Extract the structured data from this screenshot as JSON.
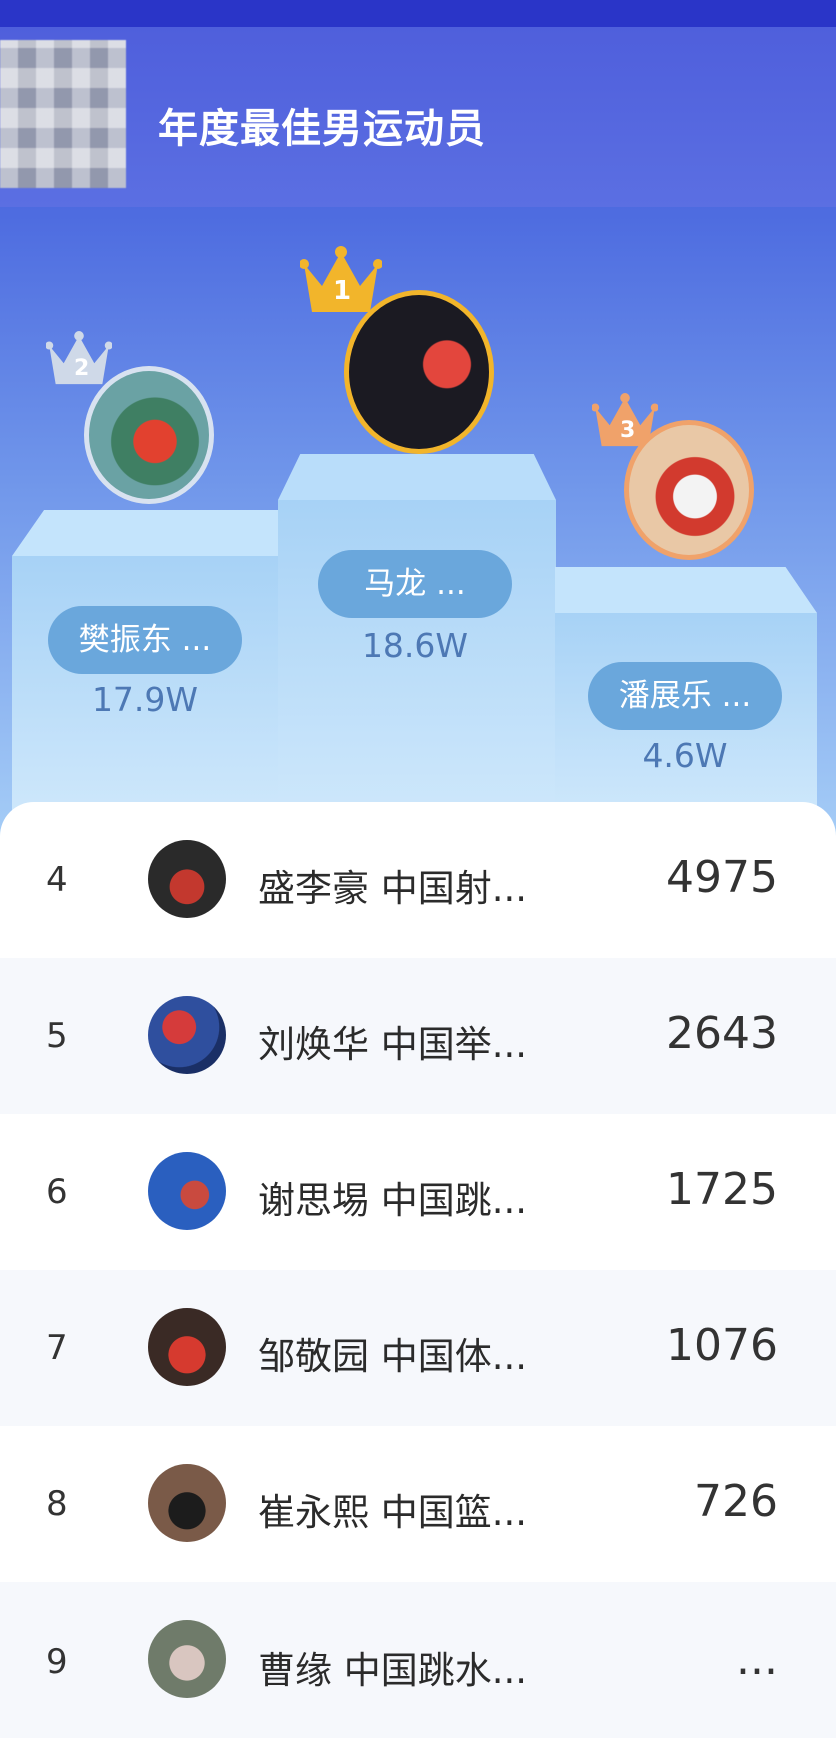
{
  "header": {
    "title": "年度最佳男运动员"
  },
  "podium": [
    {
      "rank": "2",
      "name": "樊振东 ...",
      "score": "17.9W"
    },
    {
      "rank": "1",
      "name": "马龙 ...",
      "score": "18.6W"
    },
    {
      "rank": "3",
      "name": "潘展乐 ...",
      "score": "4.6W"
    }
  ],
  "list": [
    {
      "rank": "4",
      "name": "盛李豪  中国射...",
      "value": "4975"
    },
    {
      "rank": "5",
      "name": "刘焕华  中国举...",
      "value": "2643"
    },
    {
      "rank": "6",
      "name": "谢思埸  中国跳...",
      "value": "1725"
    },
    {
      "rank": "7",
      "name": "邹敬园  中国体...",
      "value": "1076"
    },
    {
      "rank": "8",
      "name": "崔永熙  中国篮...",
      "value": "726"
    },
    {
      "rank": "9",
      "name": "曹缘  中国跳水...",
      "value": "..."
    }
  ],
  "colors": {
    "gold": "#f2b52b",
    "silver": "#d8e2f0",
    "bronze": "#f0a26a",
    "pill": "#6aa7dc"
  }
}
